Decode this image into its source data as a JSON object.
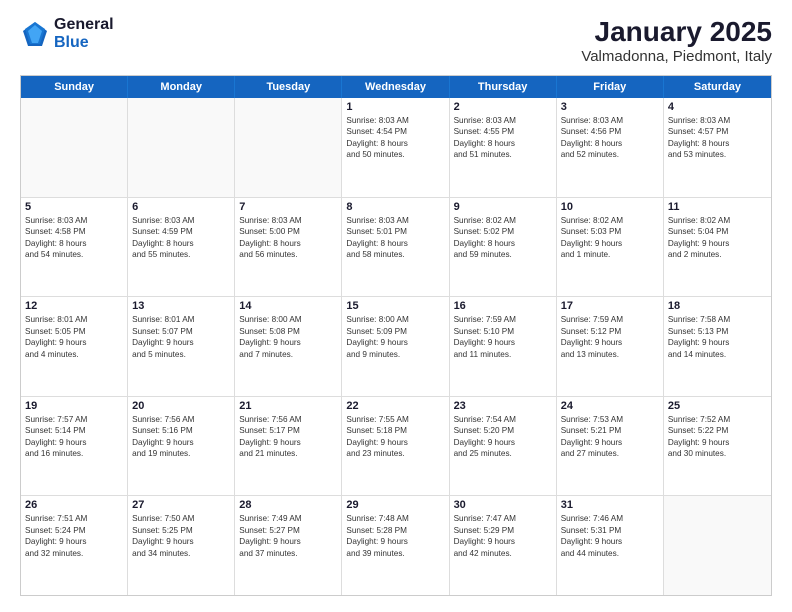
{
  "logo": {
    "general": "General",
    "blue": "Blue"
  },
  "title": "January 2025",
  "subtitle": "Valmadonna, Piedmont, Italy",
  "headers": [
    "Sunday",
    "Monday",
    "Tuesday",
    "Wednesday",
    "Thursday",
    "Friday",
    "Saturday"
  ],
  "weeks": [
    [
      {
        "day": "",
        "info": ""
      },
      {
        "day": "",
        "info": ""
      },
      {
        "day": "",
        "info": ""
      },
      {
        "day": "1",
        "info": "Sunrise: 8:03 AM\nSunset: 4:54 PM\nDaylight: 8 hours\nand 50 minutes."
      },
      {
        "day": "2",
        "info": "Sunrise: 8:03 AM\nSunset: 4:55 PM\nDaylight: 8 hours\nand 51 minutes."
      },
      {
        "day": "3",
        "info": "Sunrise: 8:03 AM\nSunset: 4:56 PM\nDaylight: 8 hours\nand 52 minutes."
      },
      {
        "day": "4",
        "info": "Sunrise: 8:03 AM\nSunset: 4:57 PM\nDaylight: 8 hours\nand 53 minutes."
      }
    ],
    [
      {
        "day": "5",
        "info": "Sunrise: 8:03 AM\nSunset: 4:58 PM\nDaylight: 8 hours\nand 54 minutes."
      },
      {
        "day": "6",
        "info": "Sunrise: 8:03 AM\nSunset: 4:59 PM\nDaylight: 8 hours\nand 55 minutes."
      },
      {
        "day": "7",
        "info": "Sunrise: 8:03 AM\nSunset: 5:00 PM\nDaylight: 8 hours\nand 56 minutes."
      },
      {
        "day": "8",
        "info": "Sunrise: 8:03 AM\nSunset: 5:01 PM\nDaylight: 8 hours\nand 58 minutes."
      },
      {
        "day": "9",
        "info": "Sunrise: 8:02 AM\nSunset: 5:02 PM\nDaylight: 8 hours\nand 59 minutes."
      },
      {
        "day": "10",
        "info": "Sunrise: 8:02 AM\nSunset: 5:03 PM\nDaylight: 9 hours\nand 1 minute."
      },
      {
        "day": "11",
        "info": "Sunrise: 8:02 AM\nSunset: 5:04 PM\nDaylight: 9 hours\nand 2 minutes."
      }
    ],
    [
      {
        "day": "12",
        "info": "Sunrise: 8:01 AM\nSunset: 5:05 PM\nDaylight: 9 hours\nand 4 minutes."
      },
      {
        "day": "13",
        "info": "Sunrise: 8:01 AM\nSunset: 5:07 PM\nDaylight: 9 hours\nand 5 minutes."
      },
      {
        "day": "14",
        "info": "Sunrise: 8:00 AM\nSunset: 5:08 PM\nDaylight: 9 hours\nand 7 minutes."
      },
      {
        "day": "15",
        "info": "Sunrise: 8:00 AM\nSunset: 5:09 PM\nDaylight: 9 hours\nand 9 minutes."
      },
      {
        "day": "16",
        "info": "Sunrise: 7:59 AM\nSunset: 5:10 PM\nDaylight: 9 hours\nand 11 minutes."
      },
      {
        "day": "17",
        "info": "Sunrise: 7:59 AM\nSunset: 5:12 PM\nDaylight: 9 hours\nand 13 minutes."
      },
      {
        "day": "18",
        "info": "Sunrise: 7:58 AM\nSunset: 5:13 PM\nDaylight: 9 hours\nand 14 minutes."
      }
    ],
    [
      {
        "day": "19",
        "info": "Sunrise: 7:57 AM\nSunset: 5:14 PM\nDaylight: 9 hours\nand 16 minutes."
      },
      {
        "day": "20",
        "info": "Sunrise: 7:56 AM\nSunset: 5:16 PM\nDaylight: 9 hours\nand 19 minutes."
      },
      {
        "day": "21",
        "info": "Sunrise: 7:56 AM\nSunset: 5:17 PM\nDaylight: 9 hours\nand 21 minutes."
      },
      {
        "day": "22",
        "info": "Sunrise: 7:55 AM\nSunset: 5:18 PM\nDaylight: 9 hours\nand 23 minutes."
      },
      {
        "day": "23",
        "info": "Sunrise: 7:54 AM\nSunset: 5:20 PM\nDaylight: 9 hours\nand 25 minutes."
      },
      {
        "day": "24",
        "info": "Sunrise: 7:53 AM\nSunset: 5:21 PM\nDaylight: 9 hours\nand 27 minutes."
      },
      {
        "day": "25",
        "info": "Sunrise: 7:52 AM\nSunset: 5:22 PM\nDaylight: 9 hours\nand 30 minutes."
      }
    ],
    [
      {
        "day": "26",
        "info": "Sunrise: 7:51 AM\nSunset: 5:24 PM\nDaylight: 9 hours\nand 32 minutes."
      },
      {
        "day": "27",
        "info": "Sunrise: 7:50 AM\nSunset: 5:25 PM\nDaylight: 9 hours\nand 34 minutes."
      },
      {
        "day": "28",
        "info": "Sunrise: 7:49 AM\nSunset: 5:27 PM\nDaylight: 9 hours\nand 37 minutes."
      },
      {
        "day": "29",
        "info": "Sunrise: 7:48 AM\nSunset: 5:28 PM\nDaylight: 9 hours\nand 39 minutes."
      },
      {
        "day": "30",
        "info": "Sunrise: 7:47 AM\nSunset: 5:29 PM\nDaylight: 9 hours\nand 42 minutes."
      },
      {
        "day": "31",
        "info": "Sunrise: 7:46 AM\nSunset: 5:31 PM\nDaylight: 9 hours\nand 44 minutes."
      },
      {
        "day": "",
        "info": ""
      }
    ]
  ]
}
